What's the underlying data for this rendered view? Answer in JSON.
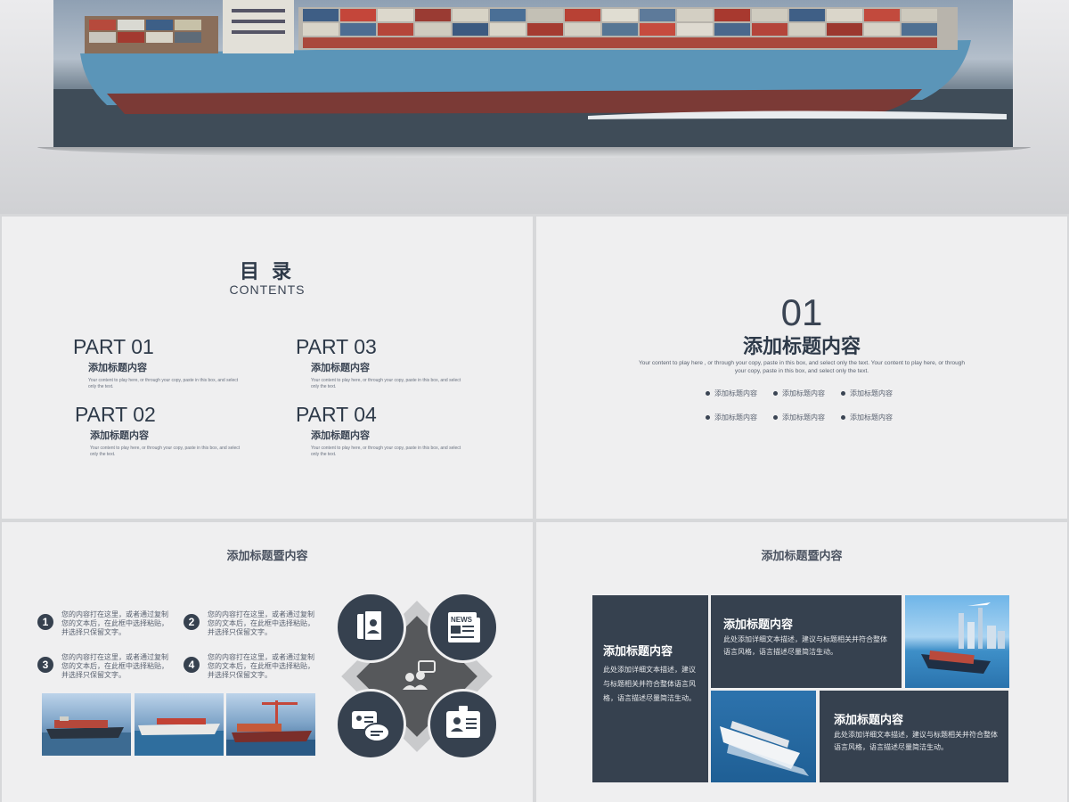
{
  "colors": {
    "accent": "#36414f",
    "slide_bg": "#efeff0"
  },
  "toc": {
    "title": "目 录",
    "subtitle": "CONTENTS",
    "parts": [
      {
        "num": "PART 01",
        "title": "添加标题内容",
        "desc": "Your content to play here, or through your copy, paste in this box, and select only the text."
      },
      {
        "num": "PART 03",
        "title": "添加标题内容",
        "desc": "Your content to play here, or through your copy, paste in this box, and select only the text."
      },
      {
        "num": "PART 02",
        "title": "添加标题内容",
        "desc": "Your content to play here, or through your copy, paste in this box, and select only the text."
      },
      {
        "num": "PART 04",
        "title": "添加标题内容",
        "desc": "Your content to play here, or through your copy, paste in this box, and select only the text."
      }
    ]
  },
  "section": {
    "number": "01",
    "title": "添加标题内容",
    "desc": "Your content to play here , or through your copy, paste in this box, and select only the text. Your content to play here, or through your copy, paste in this box, and select only the text.",
    "bullets": [
      "添加标题内容",
      "添加标题内容",
      "添加标题内容",
      "添加标题内容",
      "添加标题内容",
      "添加标题内容"
    ]
  },
  "slide3": {
    "heading": "添加标题暨内容",
    "items": [
      {
        "num": "1",
        "text": "您的内容打在这里，或者通过复制您的文本后，在此框中选择粘贴，并选择只保留文字。"
      },
      {
        "num": "2",
        "text": "您的内容打在这里，或者通过复制您的文本后，在此框中选择粘贴，并选择只保留文字。"
      },
      {
        "num": "3",
        "text": "您的内容打在这里，或者通过复制您的文本后，在此框中选择粘贴，并选择只保留文字。"
      },
      {
        "num": "4",
        "text": "您的内容打在这里，或者通过复制您的文本后，在此框中选择粘贴，并选择只保留文字。"
      }
    ],
    "icons": [
      "person-book-icon",
      "news-icon",
      "group-chat-icon",
      "user-chat-icon",
      "id-badge-icon"
    ],
    "news_label": "NEWS"
  },
  "slide4": {
    "heading": "添加标题暨内容",
    "boxes": [
      {
        "title": "添加标题内容",
        "desc": "此处添加详细文本描述，建议与标题相关并符合整体语言风格，语言描述尽量简洁生动。"
      },
      {
        "title": "添加标题内容",
        "desc": "此处添加详细文本描述，建议与标题相关并符合整体语言风格，语言描述尽量简洁生动。"
      },
      {
        "title": "添加标题内容",
        "desc": "此处添加详细文本描述，建议与标题相关并符合整体语言风格，语言描述尽量简洁生动。"
      }
    ]
  }
}
